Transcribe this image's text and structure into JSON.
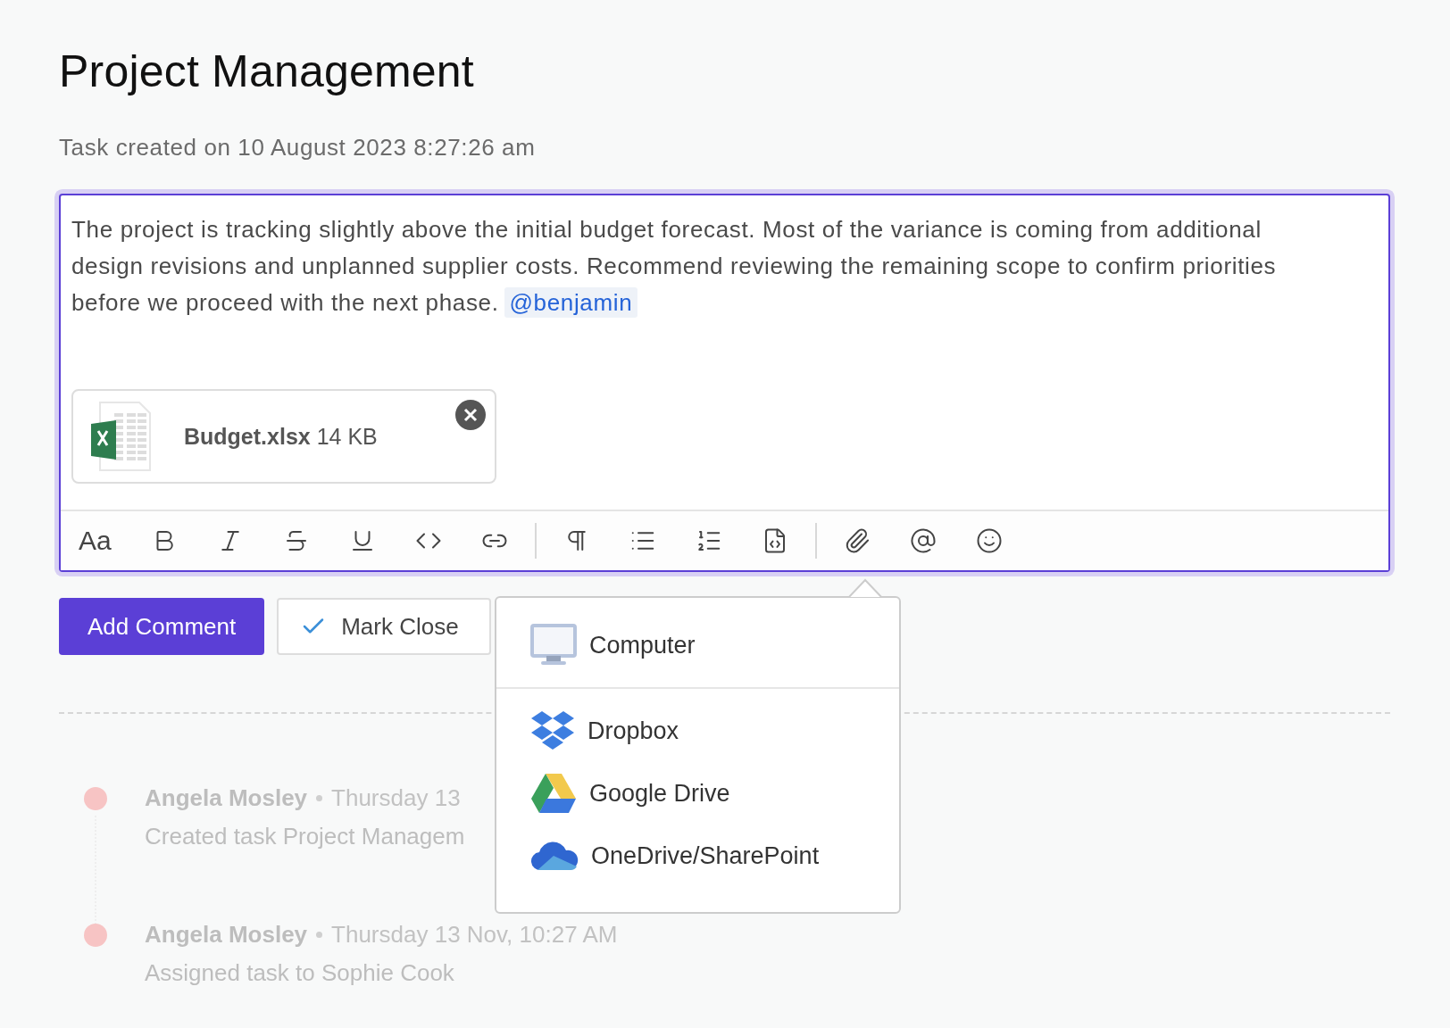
{
  "page": {
    "title": "Project Management",
    "subtitle": "Task created on 10 August 2023 8:27:26 am"
  },
  "editor": {
    "focused": true,
    "text": "The project is tracking slightly above the initial budget forecast. Most of the variance is coming from additional design revisions and unplanned supplier costs. Recommend reviewing the remaining scope to confirm priorities before we proceed with the next phase.",
    "mention": "@benjamin",
    "attachment": {
      "name": "Budget.xlsx",
      "size": "14 KB"
    },
    "toolbar": [
      [
        {
          "kind": "text-size",
          "label": "Aa"
        },
        {
          "kind": "bold"
        },
        {
          "kind": "italic"
        },
        {
          "kind": "strike"
        },
        {
          "kind": "underline"
        },
        {
          "kind": "code"
        },
        {
          "kind": "link"
        }
      ],
      [
        {
          "kind": "paragraph"
        },
        {
          "kind": "bullets"
        },
        {
          "kind": "numbers"
        },
        {
          "kind": "code-block"
        }
      ],
      [
        {
          "kind": "attach"
        },
        {
          "kind": "mention"
        },
        {
          "kind": "emoji"
        }
      ]
    ]
  },
  "actions": {
    "primary": "Add Comment",
    "secondary": "Mark Close"
  },
  "attach_menu": {
    "open": true,
    "sections": [
      [
        {
          "kind": "computer",
          "label": "Computer"
        }
      ],
      [
        {
          "kind": "dropbox",
          "label": "Dropbox"
        },
        {
          "kind": "drive",
          "label": "Google Drive"
        },
        {
          "kind": "onedrive",
          "label": "OneDrive/SharePoint"
        }
      ]
    ]
  },
  "activity": [
    {
      "author": "Angela Mosley",
      "time": "Thursday 13",
      "text": "Created task Project Managem"
    },
    {
      "author": "Angela Mosley",
      "time": "Thursday 13 Nov, 10:27 AM",
      "text": "Assigned task to Sophie Cook"
    }
  ]
}
